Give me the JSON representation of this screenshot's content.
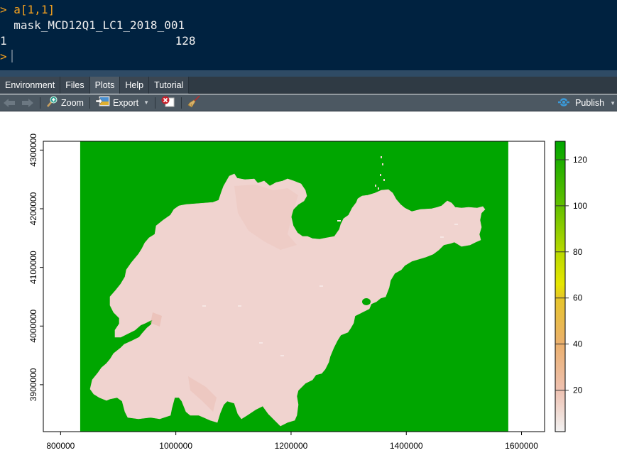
{
  "console": {
    "prompt_symbol": ">",
    "command": "a[1,1]",
    "output_header": "  mask_MCD12Q1_LC1_2018_001",
    "output_row_index": "1",
    "output_row_value": "128"
  },
  "tabs": [
    {
      "label": "Environment",
      "active": false
    },
    {
      "label": "Files",
      "active": false
    },
    {
      "label": "Plots",
      "active": true
    },
    {
      "label": "Help",
      "active": false
    },
    {
      "label": "Tutorial",
      "active": false
    }
  ],
  "toolbar": {
    "back_icon": "arrow-left-icon",
    "forward_icon": "arrow-right-icon",
    "zoom_label": "Zoom",
    "export_label": "Export",
    "remove_icon": "remove-plot-icon",
    "clear_icon": "broom-icon",
    "publish_label": "Publish"
  },
  "colors": {
    "console_bg": "#002240",
    "prompt": "#f4a11f",
    "water_green": "#00a600",
    "land_pink": "#f0d3cf",
    "publish_blue": "#3a9ad9"
  },
  "chart_data": {
    "type": "heatmap",
    "title": "",
    "xlabel": "",
    "ylabel": "",
    "xlim": [
      770000,
      1640000
    ],
    "ylim": [
      3820000,
      4315000
    ],
    "raster_x_extent": [
      834000,
      1577000
    ],
    "x_ticks": [
      800000,
      1000000,
      1200000,
      1400000,
      1600000
    ],
    "x_tick_labels": [
      "800000",
      "1000000",
      "1200000",
      "1400000",
      "1600000"
    ],
    "y_ticks": [
      3900000,
      4000000,
      4100000,
      4200000,
      4300000
    ],
    "y_tick_labels": [
      "3900000",
      "4000000",
      "4100000",
      "4200000",
      "4300000"
    ],
    "legend": {
      "placement": "right",
      "range": [
        2,
        128
      ],
      "ticks": [
        20,
        40,
        60,
        80,
        100,
        120
      ],
      "tick_labels": [
        "20",
        "40",
        "60",
        "80",
        "100",
        "120"
      ],
      "color_stops": [
        {
          "value": 2,
          "color": "#f2f2f2"
        },
        {
          "value": 20,
          "color": "#eec1b1"
        },
        {
          "value": 40,
          "color": "#ebb06e"
        },
        {
          "value": 60,
          "color": "#e6c52a"
        },
        {
          "value": 66,
          "color": "#e6e600"
        },
        {
          "value": 80,
          "color": "#b8d900"
        },
        {
          "value": 100,
          "color": "#63c000"
        },
        {
          "value": 128,
          "color": "#00a600"
        }
      ]
    },
    "values_description": "Masked land cover raster: water/background pixels = 128 (green); land pixels ~5-15 (pink)",
    "background_value": 128,
    "land_value_approx": 10
  }
}
